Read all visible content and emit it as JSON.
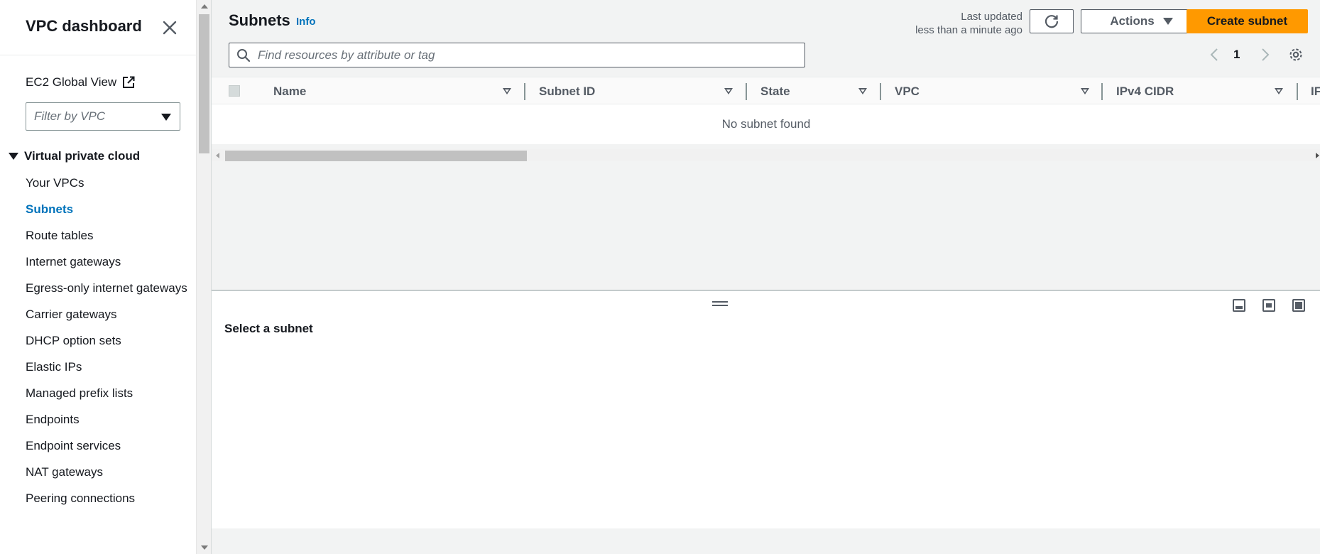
{
  "sidebar": {
    "title": "VPC dashboard",
    "global_view": "EC2 Global View",
    "filter_placeholder": "Filter by VPC",
    "section": "Virtual private cloud",
    "items": [
      {
        "label": "Your VPCs"
      },
      {
        "label": "Subnets",
        "active": true
      },
      {
        "label": "Route tables"
      },
      {
        "label": "Internet gateways"
      },
      {
        "label": "Egress-only internet gateways"
      },
      {
        "label": "Carrier gateways"
      },
      {
        "label": "DHCP option sets"
      },
      {
        "label": "Elastic IPs"
      },
      {
        "label": "Managed prefix lists"
      },
      {
        "label": "Endpoints"
      },
      {
        "label": "Endpoint services"
      },
      {
        "label": "NAT gateways"
      },
      {
        "label": "Peering connections"
      }
    ]
  },
  "header": {
    "title": "Subnets",
    "info": "Info",
    "last_updated_line1": "Last updated",
    "last_updated_line2": "less than a minute ago",
    "actions_label": "Actions",
    "create_label": "Create subnet"
  },
  "search": {
    "placeholder": "Find resources by attribute or tag"
  },
  "pagination": {
    "page": "1"
  },
  "table": {
    "columns": [
      "Name",
      "Subnet ID",
      "State",
      "VPC",
      "IPv4 CIDR",
      "IF"
    ],
    "empty_message": "No subnet found"
  },
  "split_panel": {
    "title": "Select a subnet"
  },
  "colors": {
    "accent": "#0073bb",
    "primary_button": "#ff9900",
    "text": "#16191f",
    "muted": "#545b64"
  }
}
